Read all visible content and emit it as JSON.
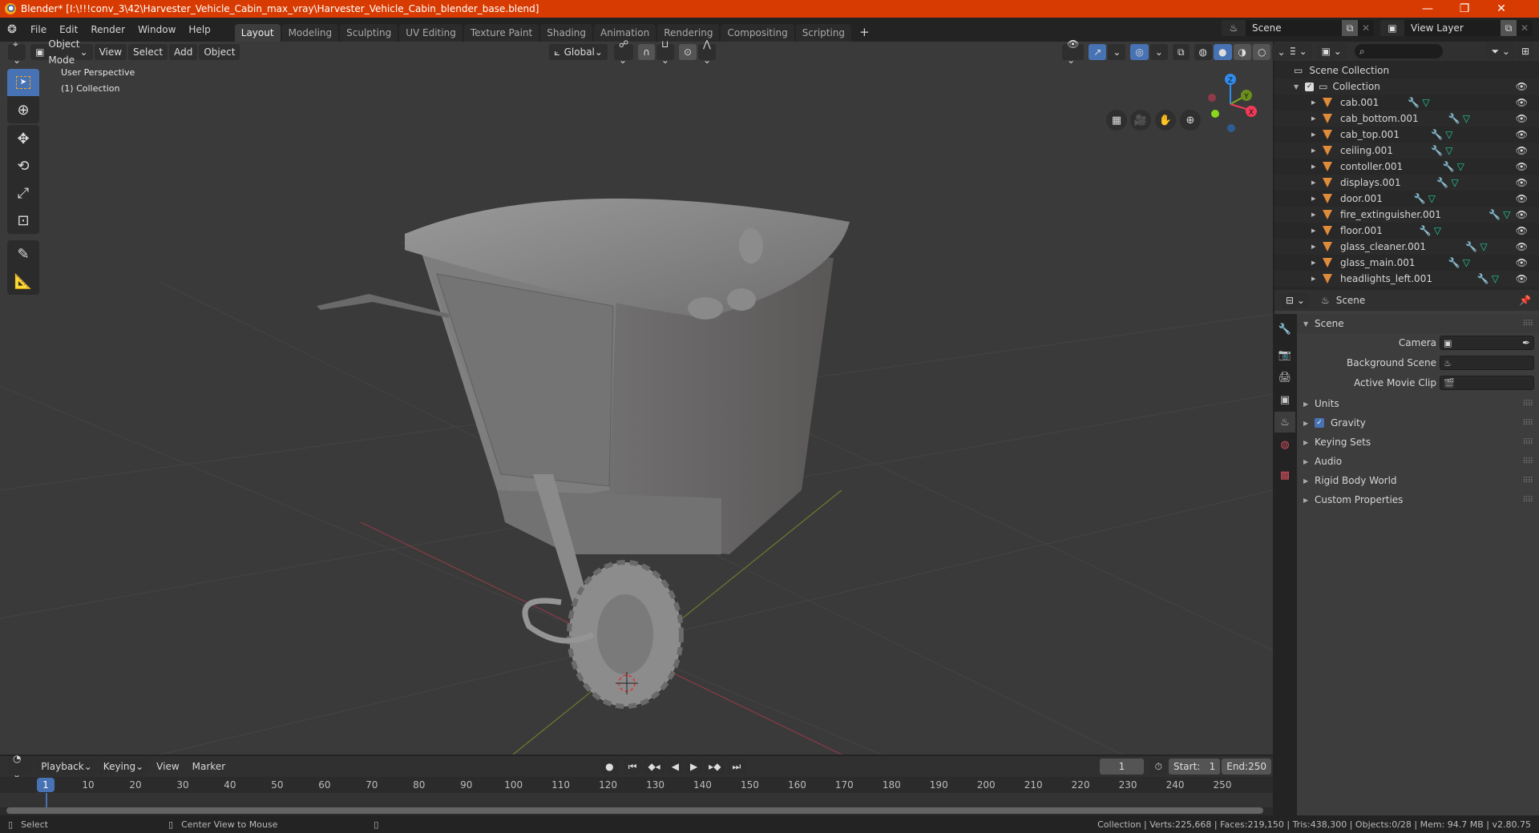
{
  "window": {
    "title": "Blender* [I:\\!!!conv_3\\42\\Harvester_Vehicle_Cabin_max_vray\\Harvester_Vehicle_Cabin_blender_base.blend]",
    "controls": {
      "minimize": "—",
      "maximize": "❐",
      "close": "✕"
    }
  },
  "menu": {
    "items": [
      "File",
      "Edit",
      "Render",
      "Window",
      "Help"
    ],
    "workspaces": [
      "Layout",
      "Modeling",
      "Sculpting",
      "UV Editing",
      "Texture Paint",
      "Shading",
      "Animation",
      "Rendering",
      "Compositing",
      "Scripting"
    ],
    "active_workspace": "Layout",
    "add_workspace": "+",
    "scene": "Scene",
    "view_layer": "View Layer"
  },
  "viewport": {
    "mode": "Object Mode",
    "menus": [
      "View",
      "Select",
      "Add",
      "Object"
    ],
    "orientation": "Global",
    "overlay_text": {
      "perspective": "User Perspective",
      "collection": "(1) Collection"
    },
    "gizmo": {
      "x": "X",
      "y": "Y",
      "z": "Z"
    },
    "colors": {
      "x": "#f23a58",
      "y": "#7faa1f",
      "z": "#2f8df0",
      "active": "#4772b3"
    }
  },
  "outliner": {
    "root": "Scene Collection",
    "collection": "Collection",
    "objects": [
      "cab.001",
      "cab_bottom.001",
      "cab_top.001",
      "ceiling.001",
      "contoller.001",
      "displays.001",
      "door.001",
      "fire_extinguisher.001",
      "floor.001",
      "glass_cleaner.001",
      "glass_main.001",
      "headlights_left.001"
    ]
  },
  "properties": {
    "context": "Scene",
    "panel_title": "Scene",
    "fields": [
      {
        "label": "Camera",
        "value": ""
      },
      {
        "label": "Background Scene",
        "value": ""
      },
      {
        "label": "Active Movie Clip",
        "value": ""
      }
    ],
    "sections": [
      {
        "label": "Units",
        "checkbox": false
      },
      {
        "label": "Gravity",
        "checkbox": true,
        "checked": true
      },
      {
        "label": "Keying Sets",
        "checkbox": false
      },
      {
        "label": "Audio",
        "checkbox": false
      },
      {
        "label": "Rigid Body World",
        "checkbox": false
      },
      {
        "label": "Custom Properties",
        "checkbox": false
      }
    ]
  },
  "timeline": {
    "menus": [
      "Playback",
      "Keying",
      "View",
      "Marker"
    ],
    "current_frame": "1",
    "start_label": "Start:",
    "start": "1",
    "end_label": "End:",
    "end": "250",
    "ticks": [
      "10",
      "20",
      "30",
      "40",
      "50",
      "60",
      "70",
      "80",
      "90",
      "100",
      "110",
      "120",
      "130",
      "140",
      "150",
      "160",
      "170",
      "180",
      "190",
      "200",
      "210",
      "220",
      "230",
      "240",
      "250"
    ]
  },
  "statusbar": {
    "left_action": "Select",
    "middle_action": "Center View to Mouse",
    "stats": "Collection | Verts:225,668 | Faces:219,150 | Tris:438,300 | Objects:0/28 | Mem: 94.7 MB | v2.80.75"
  }
}
